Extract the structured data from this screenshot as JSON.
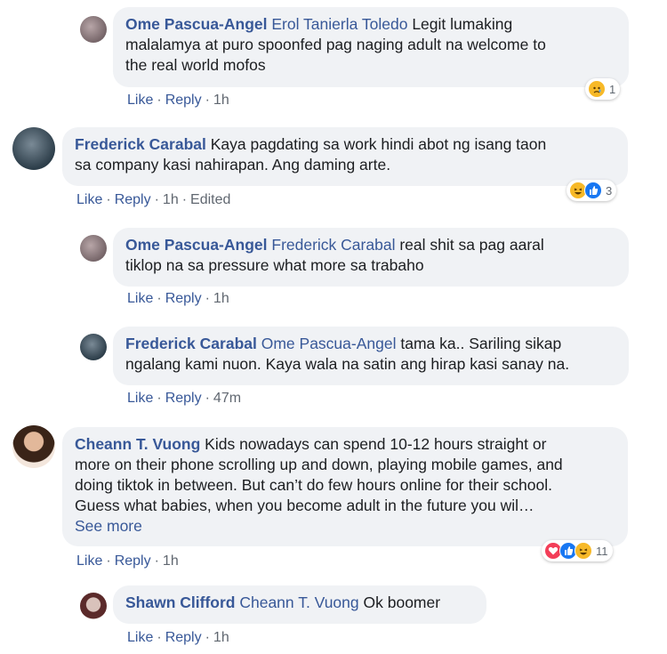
{
  "comments": [
    {
      "author": "Ome Pascua-Angel",
      "mention": "Erol Tanierla Toledo",
      "text_lines": [
        "Legit lumaking",
        "malalamya at puro spoonfed pag naging adult na welcome to",
        "the real world mofos"
      ],
      "actions": {
        "like": "Like",
        "reply": "Reply",
        "time": "1h"
      },
      "reactions": {
        "icons": [
          "sad-icon"
        ],
        "count": "1"
      }
    },
    {
      "author": "Frederick Carabal",
      "text_lines": [
        "Kaya pagdating sa work hindi abot ng isang taon",
        "sa company kasi nahirapan. Ang daming arte."
      ],
      "actions": {
        "like": "Like",
        "reply": "Reply",
        "time": "1h",
        "edited": "Edited"
      },
      "reactions": {
        "icons": [
          "haha-icon",
          "like-icon"
        ],
        "count": "3"
      }
    },
    {
      "author": "Ome Pascua-Angel",
      "mention": "Frederick Carabal",
      "text_lines": [
        "real shit sa pag aaral",
        "tiklop na sa pressure what more sa trabaho"
      ],
      "actions": {
        "like": "Like",
        "reply": "Reply",
        "time": "1h"
      }
    },
    {
      "author": "Frederick Carabal",
      "mention": "Ome Pascua-Angel",
      "text_lines": [
        "tama ka.. Sariling sikap",
        "ngalang kami nuon. Kaya wala na satin ang hirap kasi sanay na."
      ],
      "actions": {
        "like": "Like",
        "reply": "Reply",
        "time": "47m"
      }
    },
    {
      "author": "Cheann T. Vuong",
      "text_lines": [
        "Kids nowadays can spend 10-12 hours straight or",
        "more on their phone scrolling up and down, playing mobile games, and",
        "doing tiktok in between. But can’t do few hours online for their school.",
        "Guess what babies, when you become adult in the future you wil…"
      ],
      "see_more": "See more",
      "actions": {
        "like": "Like",
        "reply": "Reply",
        "time": "1h"
      },
      "reactions": {
        "icons": [
          "love-icon",
          "like-icon",
          "haha-icon"
        ],
        "count": "11"
      }
    },
    {
      "author": "Shawn Clifford",
      "mention": "Cheann T. Vuong",
      "text_lines": [
        "Ok boomer"
      ],
      "actions": {
        "like": "Like",
        "reply": "Reply",
        "time": "1h"
      }
    }
  ],
  "colors": {
    "link": "#385898",
    "bubble": "#f0f2f5",
    "meta": "#606770"
  }
}
